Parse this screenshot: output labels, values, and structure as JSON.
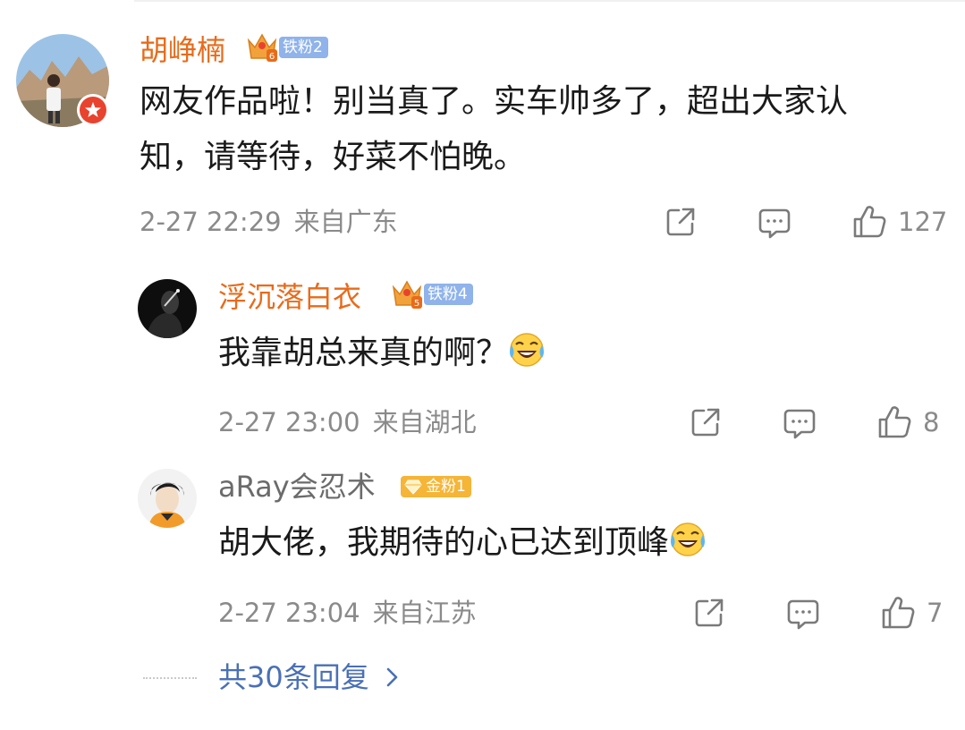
{
  "comments": [
    {
      "name": "胡峥楠",
      "badge": "铁粉2",
      "badge_level": "6",
      "text_line1": "网友作品啦！别当真了。实车帅多了，超出大家认",
      "text_line2": "知，请等待，好菜不怕晚。",
      "date": "2-27 22:29",
      "location": "来自广东",
      "likes": "127"
    }
  ],
  "replies": [
    {
      "name": "浮沉落白衣",
      "badge": "铁粉4",
      "badge_level": "5",
      "text": "我靠胡总来真的啊？",
      "emoji": "laugh-cry-emoji",
      "date": "2-27 23:00",
      "location": "来自湖北",
      "likes": "8"
    },
    {
      "name": "aRay会忍术",
      "badge": "金粉1",
      "text": "胡大佬，我期待的心已达到顶峰",
      "emoji": "laugh-cry-emoji",
      "date": "2-27 23:04",
      "location": "来自江苏",
      "likes": "7"
    }
  ],
  "more_replies": "共30条回复",
  "colors": {
    "name_orange": "#e86b1a",
    "name_gray": "#6b6b6b",
    "meta_gray": "#8a8a8a",
    "link_blue": "#4a70b5",
    "badge_blue": "#8fb3ea",
    "badge_gold": "#f5b537",
    "verified_red": "#e8432f"
  }
}
